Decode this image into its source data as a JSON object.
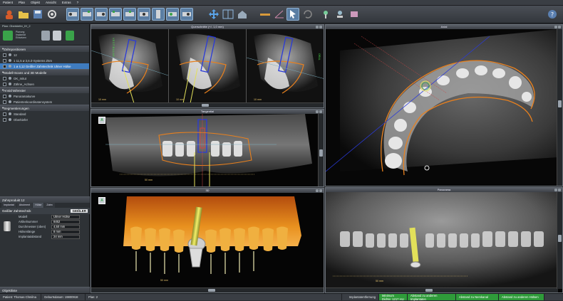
{
  "menu": [
    "Patient",
    "Plan",
    "Objekt",
    "Ansicht",
    "Extras",
    "?"
  ],
  "sidebar": {
    "plan_label": "Plan",
    "plan_value": "Oberkiefer_IH_2",
    "toolbar_text": "Planung\nImplantat\nEinsetzen",
    "sections": [
      {
        "title": "Zahnpositionen",
        "rows": [
          {
            "text": "12",
            "selected": false
          },
          {
            "text": "1  11,5  ø 3,6    Z-Systems Z5m",
            "selected": false
          },
          {
            "text": "1  ø 4,12  Geißler Zahntechnik Ulmer Hülse",
            "selected": true
          }
        ]
      },
      {
        "title": "Modell-Scans und 3D Modelle",
        "rows": [
          {
            "text": "OK_mitut",
            "selected": false
          },
          {
            "text": "Zähne_Achsen",
            "selected": false
          }
        ]
      },
      {
        "title": "Ansichtsfenster",
        "rows": [
          {
            "text": "Panoramakurve",
            "selected": false
          },
          {
            "text": "Patientenkoordinatensystem",
            "selected": false
          }
        ]
      },
      {
        "title": "Segmentierungen",
        "rows": [
          {
            "text": "Standard",
            "selected": false
          },
          {
            "text": "Oberkiefer",
            "selected": false
          }
        ]
      }
    ],
    "props_title": "Zahnprodukt 12",
    "props_tabs": [
      "Implantat",
      "Abutment",
      "Hülse",
      "Zahn"
    ],
    "brand": "Geißler Zahntechnik",
    "brand_logo": "GEIßLER",
    "fields": [
      {
        "label": "Modell",
        "value": "Ulmer Hülse"
      },
      {
        "label": "Artikelnummer",
        "value": "8452"
      },
      {
        "label": "Durchmesser (oben)",
        "value": "4,50 mm"
      },
      {
        "label": "Hülsenlänge",
        "value": "8 mm"
      },
      {
        "label": "Implantatabstand",
        "value": "24 mm"
      }
    ],
    "bottom_label": "Objektliste"
  },
  "views": {
    "quer": {
      "title": "Querschnitte (+/- 1,0 mm)",
      "scale": "10 mm",
      "label_left": "VESTIBULAR",
      "label_right": "ORAL"
    },
    "axial": {
      "title": "Axial"
    },
    "tangential": {
      "title": "Tangential",
      "scale": "50 mm",
      "cube_label": "A"
    },
    "view3d": {
      "title": "3D",
      "scale": "50 mm",
      "cube_label": "A"
    },
    "panorama": {
      "title": "Panorama",
      "scale": "50 mm"
    }
  },
  "status": {
    "patient": "Patient: Thomas Chmilna",
    "birth": "Geburtsdatum: 19800918",
    "plan": "Plan: 2",
    "impl_label": "Implantatentfernung",
    "green": [
      "Minimum Dichte: 1217 HU",
      "Abstand zu anderen Implantaten",
      "Abstand zu Nervkanal",
      "Abstand zu anderen Hülsen"
    ]
  },
  "colors": {
    "accent": "#3f7cbf",
    "orange": "#e8801e",
    "blue": "#2a3ad8",
    "implant": "#e2e05a"
  }
}
